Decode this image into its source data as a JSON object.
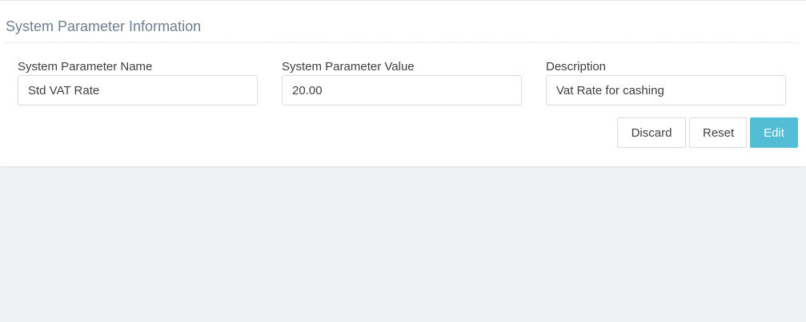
{
  "panel": {
    "title": "System Parameter Information"
  },
  "fields": {
    "name": {
      "label": "System Parameter Name",
      "value": "Std VAT Rate"
    },
    "value": {
      "label": "System Parameter Value",
      "value": "20.00"
    },
    "description": {
      "label": "Description",
      "value": "Vat Rate for cashing"
    }
  },
  "actions": {
    "discard_label": "Discard",
    "reset_label": "Reset",
    "edit_label": "Edit"
  },
  "colors": {
    "accent": "#52bdd4",
    "background": "#eef2f5",
    "panel": "#ffffff"
  }
}
